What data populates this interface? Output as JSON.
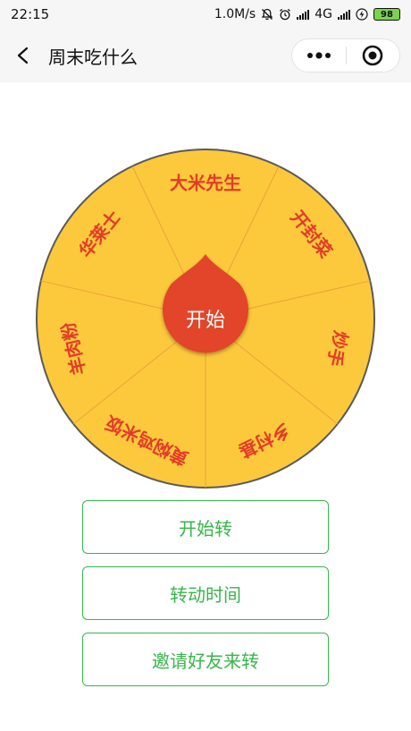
{
  "status_bar": {
    "time": "22:15",
    "network_speed": "1.0M/s",
    "network_type": "4G",
    "battery": "98"
  },
  "nav": {
    "title": "周末吃什么"
  },
  "wheel": {
    "segments": [
      "大米先生",
      "开封菜",
      "炒手",
      "乡村基",
      "黄焖鸡米饭",
      "羊肉粉",
      "华莱士"
    ],
    "center_label": "开始",
    "colors": {
      "segment_fill": "#fdc93c",
      "segment_line": "#e9a23a",
      "text": "#e33b29",
      "pointer": "#e2452a",
      "border": "#5a5a5a"
    }
  },
  "buttons": {
    "start": "开始转",
    "spin_time": "转动时间",
    "invite": "邀请好友来转"
  },
  "colors": {
    "accent": "#39b54a",
    "header_bg": "#f6f6f6"
  }
}
